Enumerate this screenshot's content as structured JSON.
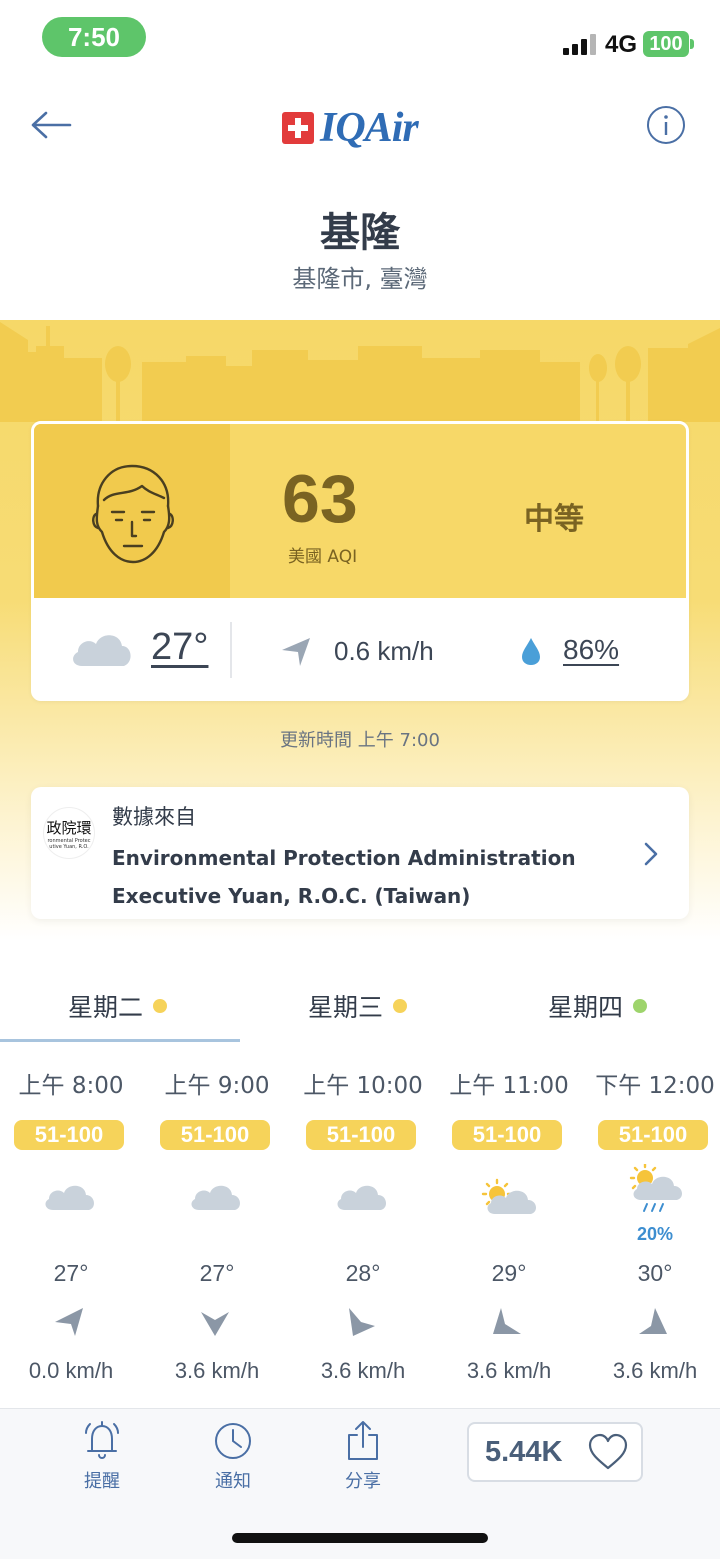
{
  "status_bar": {
    "time": "7:50",
    "network": "4G",
    "battery": "100"
  },
  "header": {
    "brand": "IQAir"
  },
  "location": {
    "city": "基隆",
    "region": "基隆市, 臺灣"
  },
  "aqi": {
    "value": "63",
    "unit_label": "美國 AQI",
    "level": "中等",
    "temperature": "27°",
    "wind": "0.6 km/h",
    "humidity": "86%"
  },
  "updated": "更新時間 上午 7:00",
  "source": {
    "label": "數據來自",
    "logo_text": "政院環",
    "logo_subtext_1": "ronmental Protec",
    "logo_subtext_2": "utive Yuan, R.O.",
    "name_line1": "Environmental Protection Administration",
    "name_line2": "Executive Yuan, R.O.C. (Taiwan)"
  },
  "days": [
    {
      "label": "星期二",
      "dot_color": "#f6d35a",
      "selected": true
    },
    {
      "label": "星期三",
      "dot_color": "#f6d35a",
      "selected": false
    },
    {
      "label": "星期四",
      "dot_color": "#9ed46c",
      "selected": false
    }
  ],
  "hourly": [
    {
      "time": "上午 8:00",
      "aqi_range": "51-100",
      "weather": "cloudy",
      "precip": "",
      "temp": "27°",
      "wind_dir": "west-southwest",
      "wind": "0.0 km/h"
    },
    {
      "time": "上午 9:00",
      "aqi_range": "51-100",
      "weather": "cloudy",
      "precip": "",
      "temp": "27°",
      "wind_dir": "south",
      "wind": "3.6 km/h"
    },
    {
      "time": "上午 10:00",
      "aqi_range": "51-100",
      "weather": "cloudy",
      "precip": "",
      "temp": "28°",
      "wind_dir": "south-southeast",
      "wind": "3.6 km/h"
    },
    {
      "time": "上午 11:00",
      "aqi_range": "51-100",
      "weather": "partly-sunny",
      "precip": "",
      "temp": "29°",
      "wind_dir": "north-northwest",
      "wind": "3.6 km/h"
    },
    {
      "time": "下午 12:00",
      "aqi_range": "51-100",
      "weather": "sun-rain",
      "precip": "20%",
      "temp": "30°",
      "wind_dir": "north-northeast",
      "wind": "3.6 km/h"
    }
  ],
  "toolbar": {
    "remind_label": "提醒",
    "notify_label": "通知",
    "share_label": "分享",
    "likes": "5.44K"
  },
  "icons": {
    "back": "arrow-left-icon",
    "info": "info-icon",
    "face": "face-icon",
    "cloud": "cloud-icon",
    "wind": "wind-arrow-icon",
    "drop": "water-drop-icon",
    "chevron": "chevron-right-icon",
    "bell": "bell-icon",
    "clock": "clock-icon",
    "share": "share-icon",
    "heart": "heart-icon"
  },
  "colors": {
    "aqi_yellow": "#f7d868",
    "face_panel": "#f1ca4d",
    "aqi_text": "#7a6322",
    "accent_blue": "#4a6fa5",
    "status_green": "#5ec56a"
  }
}
